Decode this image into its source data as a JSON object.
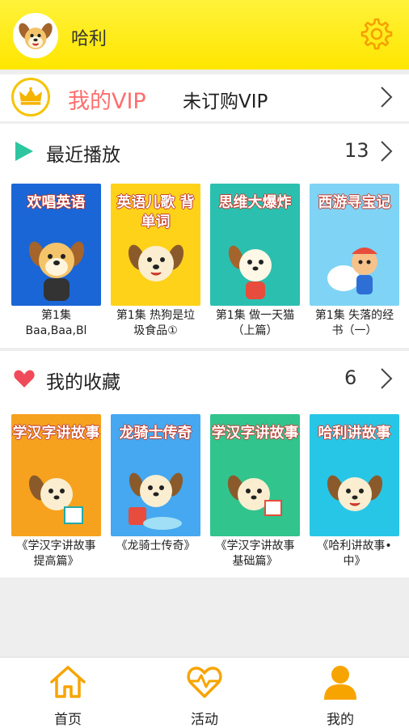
{
  "header": {
    "username": "哈利",
    "avatar_icon": "dog-avatar-icon",
    "settings_icon": "gear-icon"
  },
  "vip": {
    "title": "我的VIP",
    "status": "未订购VIP",
    "title_color": "#ff6e6e"
  },
  "recent": {
    "title": "最近播放",
    "count": "13",
    "items": [
      {
        "thumb_title": "欢唱英语",
        "caption": "第1集 Baa,Baa,Bl",
        "bg": "#1a66d6"
      },
      {
        "thumb_title": "英语儿歌 背单词",
        "caption": "第1集 热狗是垃圾食品①",
        "bg": "#ffd21a"
      },
      {
        "thumb_title": "思维大爆炸",
        "caption": "第1集 做一天猫（上篇）",
        "bg": "#2bbfb0"
      },
      {
        "thumb_title": "西游寻宝记",
        "caption": "第1集 失落的经书（一）",
        "bg": "#7fd3f5"
      }
    ]
  },
  "favorites": {
    "title": "我的收藏",
    "count": "6",
    "items": [
      {
        "thumb_title": "学汉字讲故事",
        "caption": "《学汉字讲故事提高篇》",
        "bg": "#f7a21e"
      },
      {
        "thumb_title": "龙骑士传奇",
        "caption": "《龙骑士传奇》",
        "bg": "#45a8f0"
      },
      {
        "thumb_title": "学汉字讲故事",
        "caption": "《学汉字讲故事基础篇》",
        "bg": "#31c48d"
      },
      {
        "thumb_title": "哈利讲故事",
        "caption": "《哈利讲故事•中》",
        "bg": "#28c6e6"
      }
    ]
  },
  "nav": [
    {
      "label": "首页",
      "icon": "home-icon"
    },
    {
      "label": "活动",
      "icon": "heartbeat-icon"
    },
    {
      "label": "我的",
      "icon": "person-icon"
    }
  ],
  "colors": {
    "header_yellow": "#ffe600",
    "accent_orange": "#f7a400",
    "play_green": "#2ec6a0",
    "heart_red": "#f04b5a"
  }
}
